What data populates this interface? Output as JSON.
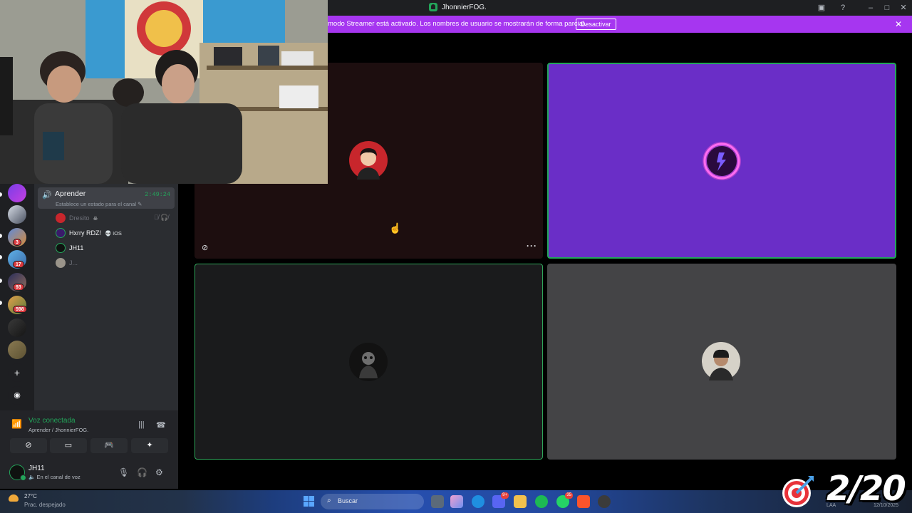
{
  "window": {
    "title": "JhonnierFOG.",
    "controls": [
      "inbox-icon",
      "help-icon",
      "minimize-icon",
      "maximize-icon",
      "close-icon"
    ]
  },
  "banner": {
    "text": "modo Streamer está activado. Los nombres de usuario se mostrarán de forma parcial.",
    "button": "Desactivar"
  },
  "servers": [
    {
      "badge": ""
    },
    {
      "badge": ""
    },
    {
      "badge": "3"
    },
    {
      "badge": "17"
    },
    {
      "badge": "93"
    },
    {
      "badge": "598"
    },
    {
      "badge": ""
    },
    {
      "badge": ""
    }
  ],
  "channel": {
    "name": "Aprender",
    "timer": "2:49:24",
    "status_placeholder": "Establece un estado para el canal",
    "members": [
      {
        "name": "Dresito",
        "tag": "☠"
      },
      {
        "name": "Hxrry RDZ!",
        "tag": "💀 iOS"
      },
      {
        "name": "JH11",
        "tag": ""
      },
      {
        "name": "J...",
        "tag": ""
      }
    ]
  },
  "voice": {
    "status": "Voz conectada",
    "location": "Aprender / JhonnierFOG.",
    "buttons": [
      "camera-off-icon",
      "screen-share-icon",
      "activities-icon",
      "soundboard-icon"
    ]
  },
  "user": {
    "name": "JH11",
    "status": "En el canal de voz"
  },
  "taskbar": {
    "weather_temp": "27°C",
    "weather_desc": "Prac. despejado",
    "search": "Buscar",
    "lang": "LAA",
    "date": "12/10/2025",
    "badges": {
      "discord": "9+",
      "whatsapp": "35"
    }
  },
  "counter": "2/20",
  "colors": {
    "accent_green": "#23a55a",
    "banner_purple": "#a636f0",
    "tile_purple": "#6a2ec7",
    "discord_dark": "#1e1f22"
  }
}
